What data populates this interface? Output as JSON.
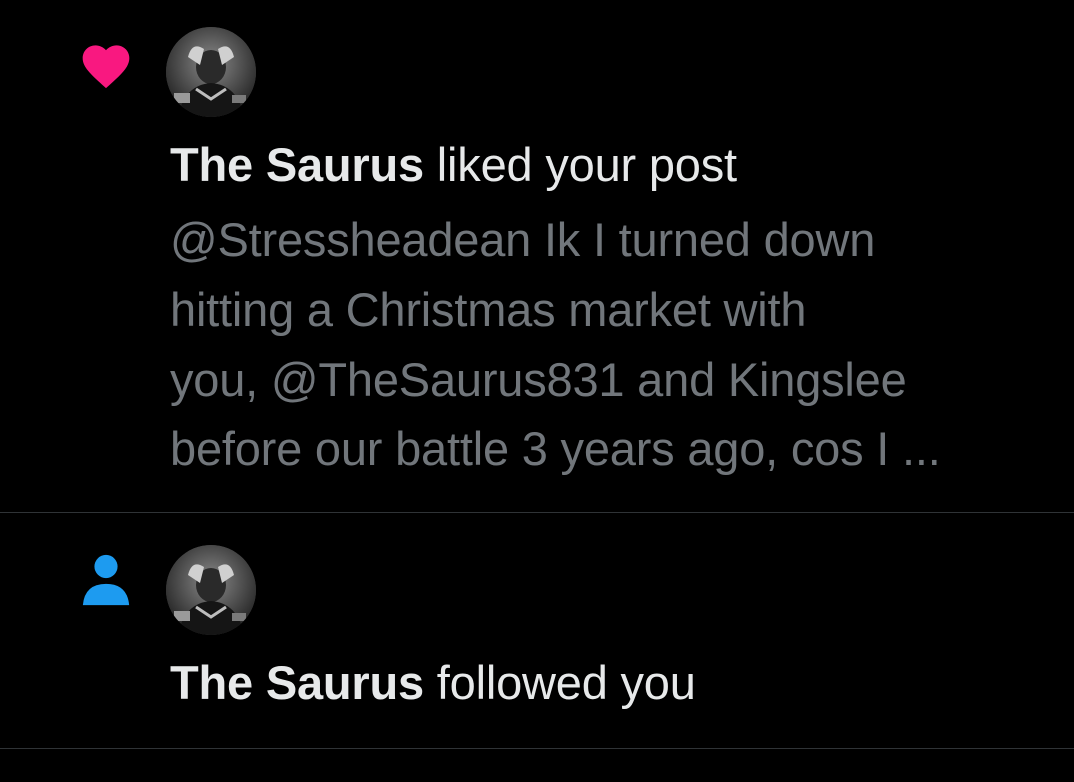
{
  "notifications": [
    {
      "type": "like",
      "icon": "heart-icon",
      "icon_color": "#f91880",
      "actor": "The Saurus",
      "action": " liked your post",
      "post_lines": [
        "@Stressheadean Ik I turned down",
        "hitting a Christmas market with",
        "you, @TheSaurus831 and Kingslee",
        "before our battle 3 years ago, cos I ..."
      ]
    },
    {
      "type": "follow",
      "icon": "person-icon",
      "icon_color": "#1d9bf0",
      "actor": "The Saurus",
      "action": " followed you"
    }
  ],
  "colors": {
    "background": "#000000",
    "primary_text": "#e7e9ea",
    "secondary_text": "#71767b",
    "divider": "#2f3336"
  }
}
